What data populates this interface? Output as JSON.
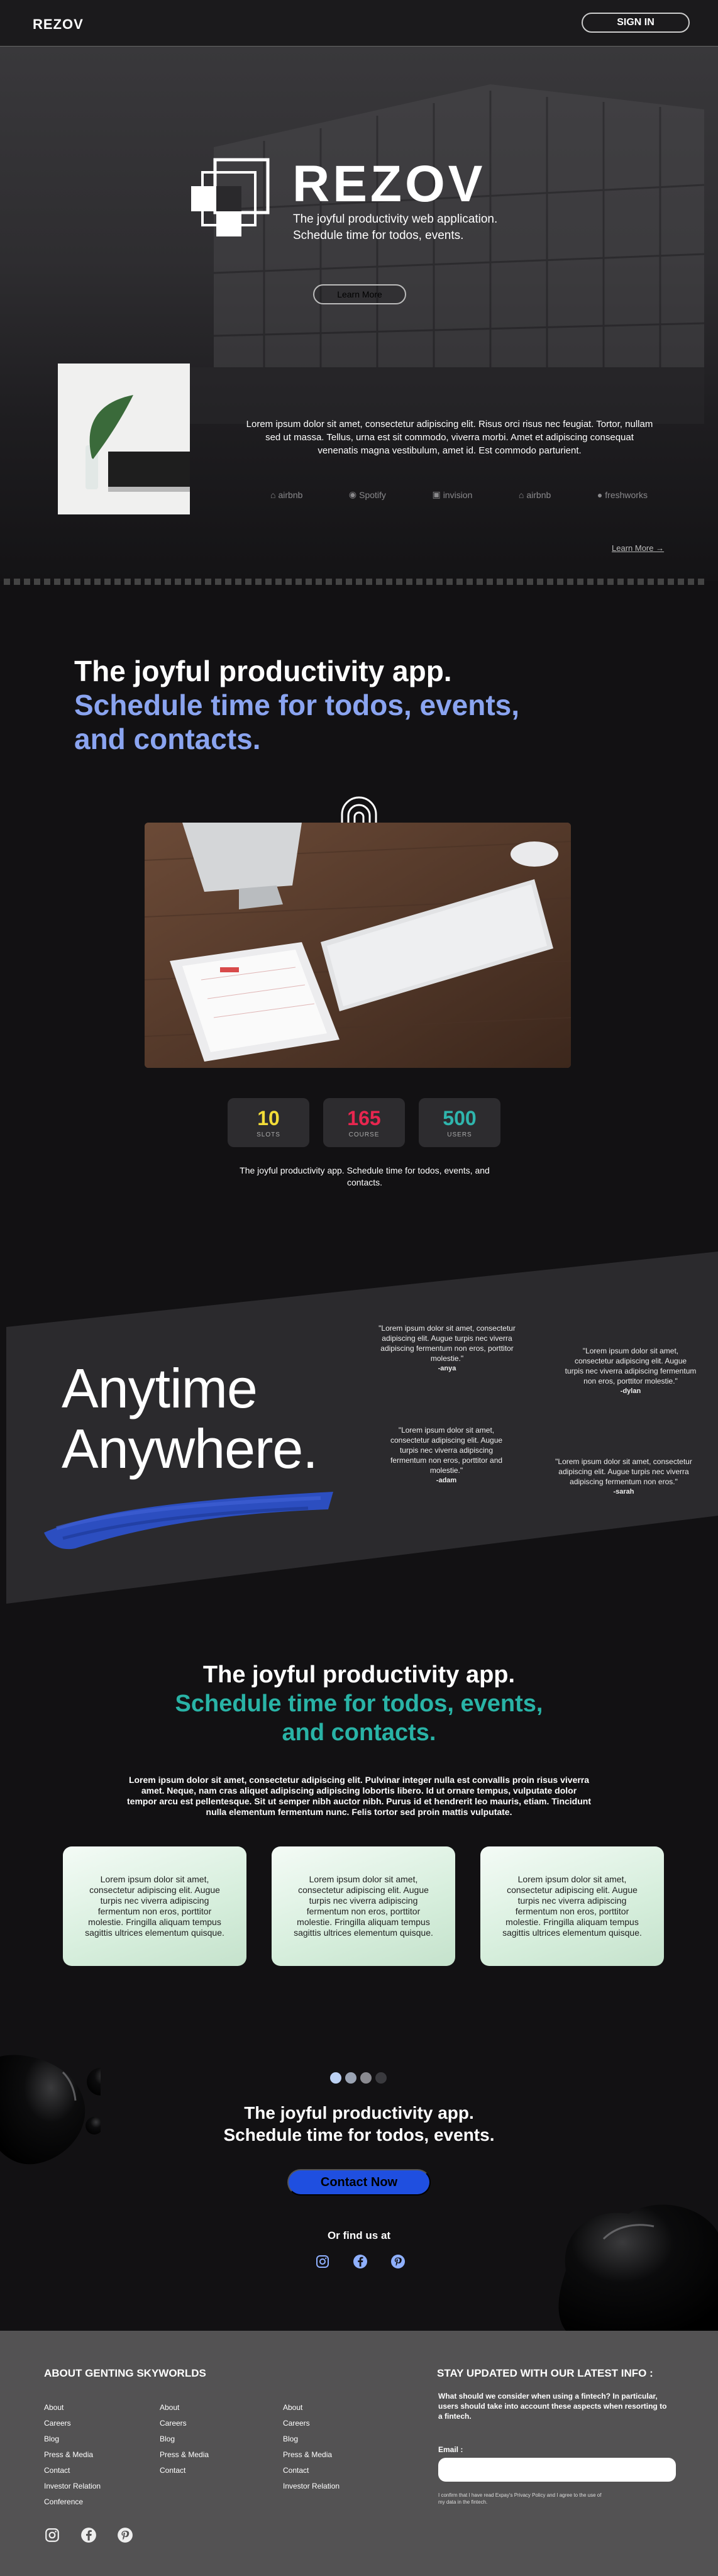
{
  "nav": {
    "brand": "REZOV",
    "signin": "SIGN IN"
  },
  "hero": {
    "title": "REZOV",
    "subtitle_1": "The joyful productivity web application.",
    "subtitle_2": "Schedule time for todos, events.",
    "button": "Learn More",
    "paragraph": "Lorem ipsum dolor sit amet, consectetur adipiscing elit. Risus orci risus nec feugiat. Tortor, nullam sed ut massa. Tellus, urna est sit commodo, viverra morbi. Amet et adipiscing consequat venenatis magna vestibulum, amet id. Est commodo parturient.",
    "logos": [
      "airbnb",
      "Spotify",
      "invision",
      "airbnb",
      "freshworks"
    ],
    "learn_more_link": "Learn More →"
  },
  "section2": {
    "heading_1": "The joyful productivity app.",
    "heading_2": "Schedule time for todos, events,",
    "heading_3": "and contacts.",
    "stats": [
      {
        "value": "10",
        "label": "SLOTS",
        "color": "#f2dc38"
      },
      {
        "value": "165",
        "label": "COURSE",
        "color": "#e8264f"
      },
      {
        "value": "500",
        "label": "USERS",
        "color": "#2fb5ad"
      }
    ],
    "caption": "The joyful productivity app. Schedule time for todos, events, and contacts."
  },
  "section3": {
    "heading_1": "Anytime",
    "heading_2": "Anywhere.",
    "quotes": [
      {
        "text": "\"Lorem ipsum dolor sit amet, consectetur adipiscing elit. Augue turpis nec viverra adipiscing fermentum non eros, porttitor molestie.\"",
        "author": "-anya"
      },
      {
        "text": "\"Lorem ipsum dolor sit amet, consectetur adipiscing elit. Augue turpis nec viverra adipiscing fermentum non eros, porttitor molestie.\"",
        "author": "-dylan"
      },
      {
        "text": "\"Lorem ipsum dolor sit amet, consectetur adipiscing elit. Augue turpis nec viverra adipiscing fermentum non eros, porttitor and molestie.\"",
        "author": "-adam"
      },
      {
        "text": "\"Lorem ipsum dolor sit amet, consectetur adipiscing elit. Augue turpis nec viverra adipiscing fermentum non eros.\"",
        "author": "-sarah"
      }
    ]
  },
  "section4": {
    "heading_1": "The joyful productivity app.",
    "heading_2": "Schedule time for todos, events,",
    "heading_3": "and contacts.",
    "paragraph": "Lorem ipsum dolor sit amet, consectetur adipiscing elit. Pulvinar integer nulla est convallis proin risus viverra amet. Neque, nam cras aliquet adipiscing adipiscing lobortis libero. Id ut ornare tempus, vulputate dolor tempor arcu est pellentesque. Sit ut semper nibh auctor nibh. Purus id et hendrerit leo mauris, etiam. Tincidunt nulla elementum fermentum nunc. Felis tortor sed proin mattis vulputate.",
    "cards": [
      "Lorem ipsum dolor sit amet, consectetur adipiscing elit. Augue turpis nec viverra adipiscing fermentum non eros, porttitor molestie. Fringilla aliquam tempus sagittis ultrices elementum quisque.",
      "Lorem ipsum dolor sit amet, consectetur adipiscing elit. Augue turpis nec viverra adipiscing fermentum non eros, porttitor molestie. Fringilla aliquam tempus sagittis ultrices elementum quisque.",
      "Lorem ipsum dolor sit amet, consectetur adipiscing elit. Augue turpis nec viverra adipiscing fermentum non eros, porttitor molestie. Fringilla aliquam tempus sagittis ultrices elementum quisque."
    ]
  },
  "cta": {
    "heading_1": "The joyful productivity app.",
    "heading_2": "Schedule time for todos, events.",
    "button": "Contact Now",
    "find_us": "Or find us at",
    "socials": [
      "instagram-icon",
      "facebook-icon",
      "pinterest-icon"
    ]
  },
  "footer": {
    "heading": "ABOUT GENTING SKYWORLDS",
    "col1": [
      "About",
      "Careers",
      "Blog",
      "Press & Media",
      "Contact",
      "Investor Relation",
      "Conference"
    ],
    "col2": [
      "About",
      "Careers",
      "Blog",
      "Press & Media",
      "Contact"
    ],
    "col3": [
      "About",
      "Careers",
      "Blog",
      "Press & Media",
      "Contact",
      "Investor Relation"
    ],
    "subscribe_heading": "STAY UPDATED WITH OUR LATEST INFO :",
    "subscribe_text": "What should we consider when using a fintech? In particular, users should take into account these aspects when resorting to a fintech.",
    "email_label": "Email :",
    "email_placeholder": "",
    "fine_print": "I confirm that I have read Expay's Privacy Policy and I agree to the use of my data in the fintech.",
    "socials": [
      "instagram-icon",
      "facebook-icon",
      "pinterest-icon"
    ]
  }
}
